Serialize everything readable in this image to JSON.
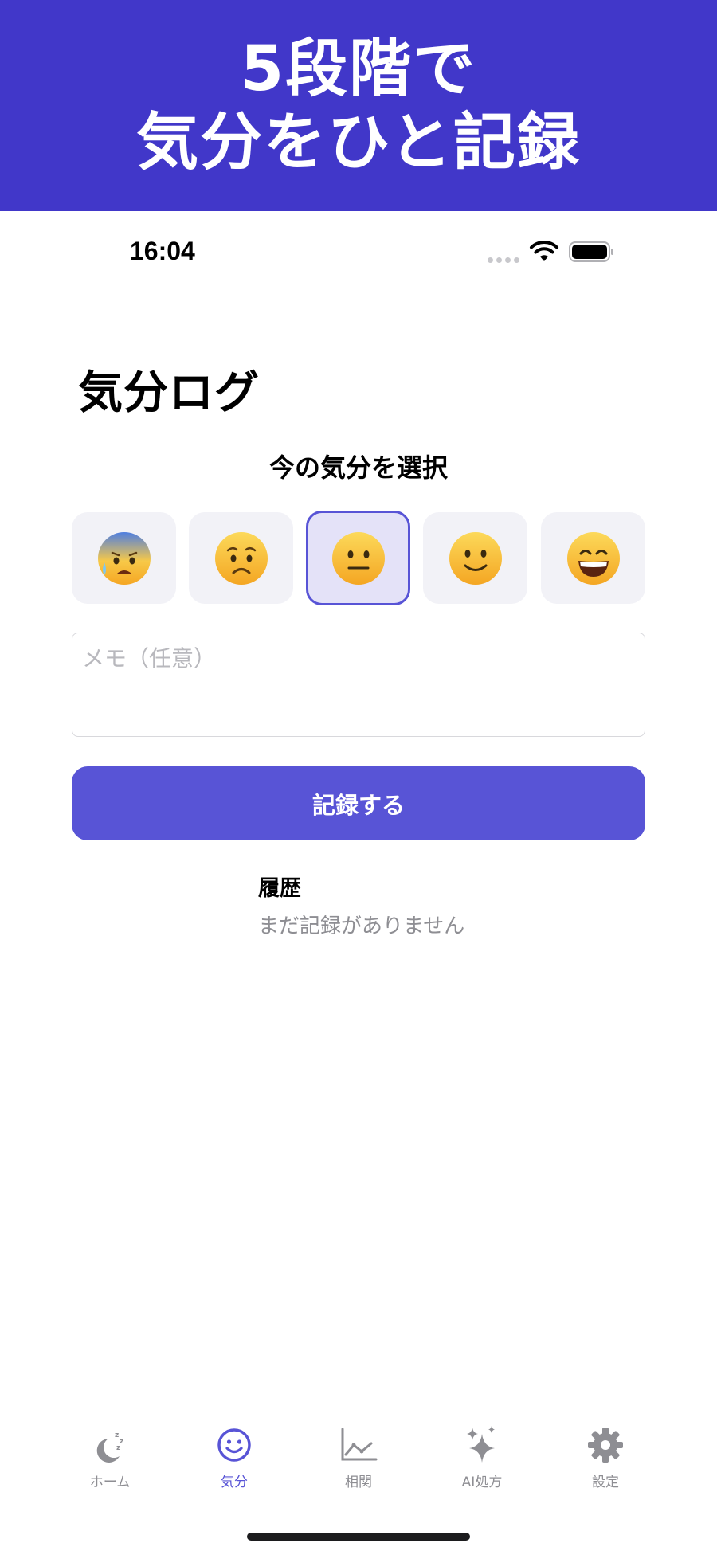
{
  "banner": {
    "line1": "5段階で",
    "line2": "気分をひと記録"
  },
  "status_bar": {
    "time": "16:04"
  },
  "page": {
    "title": "気分ログ",
    "prompt": "今の気分を選択"
  },
  "moods": [
    {
      "icon": "anxious-sweat-face-icon",
      "selected": false
    },
    {
      "icon": "worried-face-icon",
      "selected": false
    },
    {
      "icon": "neutral-face-icon",
      "selected": true
    },
    {
      "icon": "slightly-smiling-face-icon",
      "selected": false
    },
    {
      "icon": "grinning-face-icon",
      "selected": false
    }
  ],
  "memo": {
    "placeholder": "メモ（任意）",
    "value": ""
  },
  "record_button": {
    "label": "記録する"
  },
  "history": {
    "title": "履歴",
    "empty_text": "まだ記録がありません"
  },
  "tabs": [
    {
      "label": "ホーム",
      "icon": "moon-sleep-icon",
      "active": false
    },
    {
      "label": "気分",
      "icon": "smiley-face-icon",
      "active": true
    },
    {
      "label": "相関",
      "icon": "line-chart-icon",
      "active": false
    },
    {
      "label": "AI処方",
      "icon": "sparkles-icon",
      "active": false
    },
    {
      "label": "設定",
      "icon": "gear-icon",
      "active": false
    }
  ],
  "colors": {
    "banner": "#4137c9",
    "accent": "#5854d6",
    "inactive": "#8e8e93"
  }
}
